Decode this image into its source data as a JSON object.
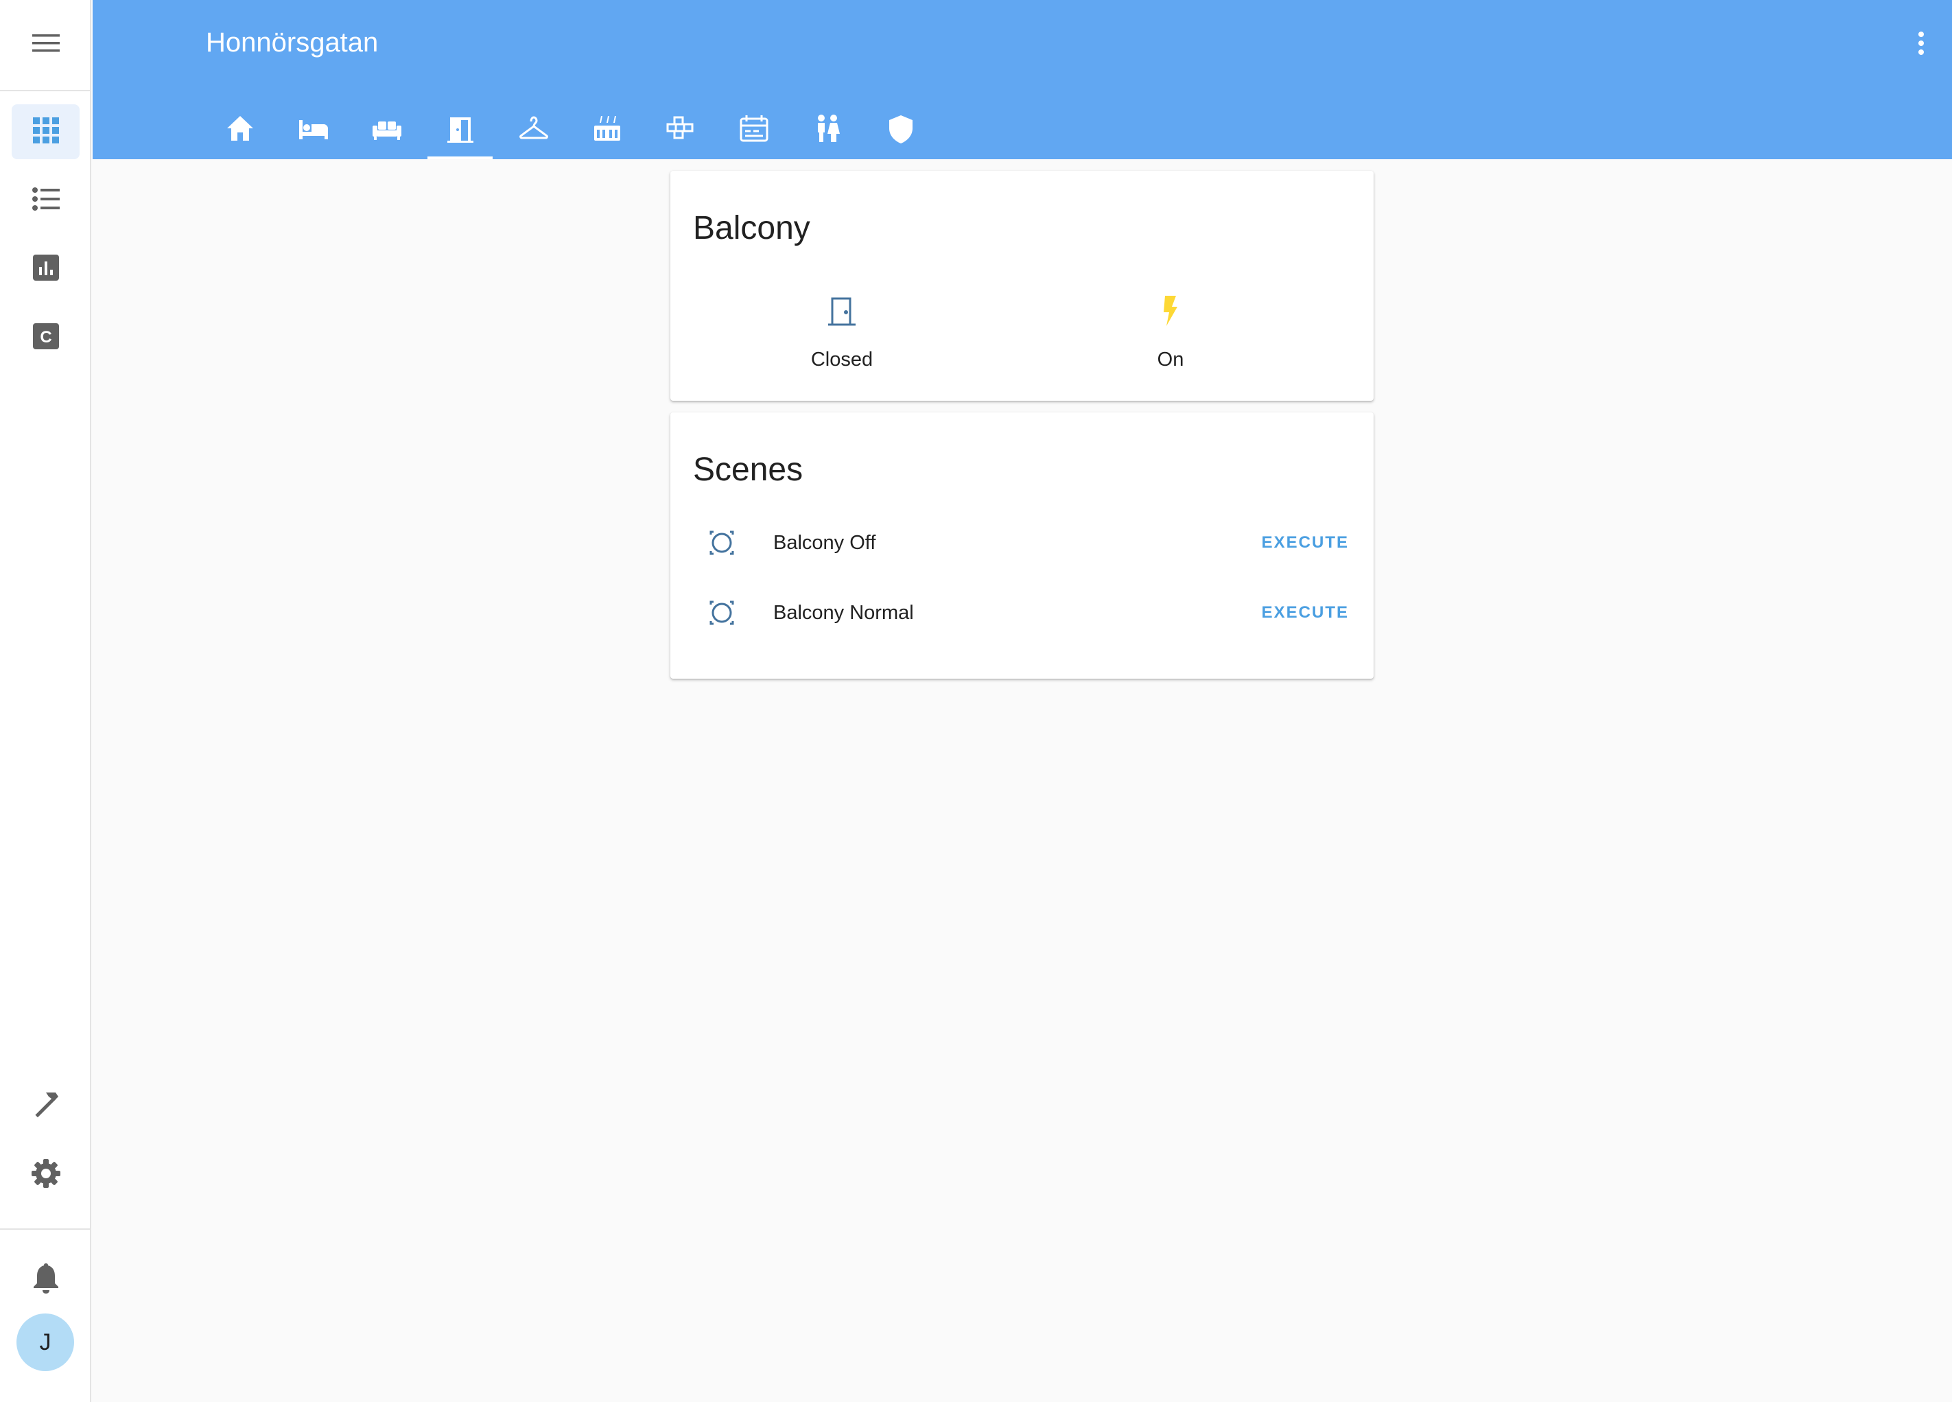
{
  "app": {
    "title": "Honnörsgatan",
    "accent_color": "#61a7f2"
  },
  "sidebar": {
    "menu_icon": "menu-icon",
    "items": [
      {
        "icon": "dashboard-grid-icon",
        "active": true
      },
      {
        "icon": "logbook-list-icon",
        "active": false
      },
      {
        "icon": "history-chart-icon",
        "active": false
      },
      {
        "icon": "configurator-c-icon",
        "active": false
      }
    ],
    "bottom_items": [
      {
        "icon": "developer-tools-hammer-icon"
      },
      {
        "icon": "settings-gear-icon"
      }
    ],
    "notifications_icon": "bell-icon",
    "user_initial": "J"
  },
  "tabs": [
    {
      "icon": "home-icon",
      "active": false
    },
    {
      "icon": "bed-icon",
      "active": false
    },
    {
      "icon": "sofa-icon",
      "active": false
    },
    {
      "icon": "door-open-icon",
      "active": true
    },
    {
      "icon": "hanger-icon",
      "active": false
    },
    {
      "icon": "stove-icon",
      "active": false
    },
    {
      "icon": "blocks-icon",
      "active": false
    },
    {
      "icon": "calendar-panel-icon",
      "active": false
    },
    {
      "icon": "people-icon",
      "active": false
    },
    {
      "icon": "shield-icon",
      "active": false
    }
  ],
  "balcony_card": {
    "title": "Balcony",
    "entities": [
      {
        "icon": "door-closed-icon",
        "state": "Closed",
        "color": "#44739e"
      },
      {
        "icon": "flash-icon",
        "state": "On",
        "color": "#fdd835"
      }
    ]
  },
  "scenes_card": {
    "title": "Scenes",
    "rows": [
      {
        "icon": "scene-icon",
        "name": "Balcony Off",
        "action": "EXECUTE"
      },
      {
        "icon": "scene-icon",
        "name": "Balcony Normal",
        "action": "EXECUTE"
      }
    ]
  }
}
